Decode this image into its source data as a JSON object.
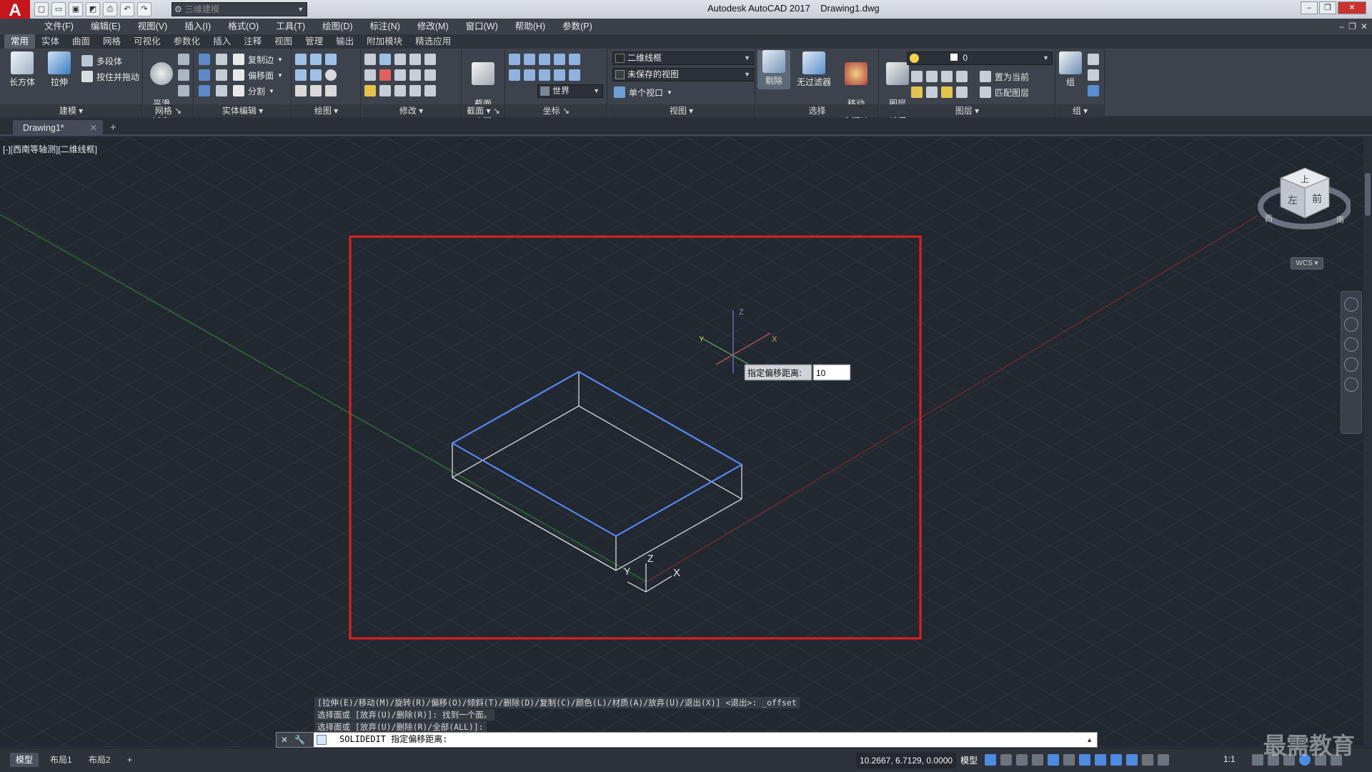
{
  "app": {
    "title": "Autodesk AutoCAD 2017    Drawing1.dwg",
    "logo_letter": "A",
    "workspace": "三维建模"
  },
  "menus": [
    "文件(F)",
    "编辑(E)",
    "视图(V)",
    "插入(I)",
    "格式(O)",
    "工具(T)",
    "绘图(D)",
    "标注(N)",
    "修改(M)",
    "窗口(W)",
    "帮助(H)",
    "参数(P)"
  ],
  "ribbon_tabs": [
    "常用",
    "实体",
    "曲面",
    "网格",
    "可视化",
    "参数化",
    "插入",
    "注释",
    "视图",
    "管理",
    "输出",
    "附加模块",
    "精选应用"
  ],
  "ribbon": {
    "modeling": {
      "box": "长方体",
      "extrude": "拉伸",
      "polysolid": "多段体",
      "presspull": "按住并拖动",
      "title": "建模"
    },
    "mesh": {
      "smooth": "平滑\n对象",
      "title": "网格"
    },
    "solid_edit": {
      "copy_edges": "复制边",
      "offset_faces": "偏移面",
      "separate": "分割",
      "title": "实体编辑"
    },
    "draw": {
      "title": "绘图"
    },
    "modify": {
      "title": "修改"
    },
    "section": {
      "plane": "截面\n平面",
      "title": "截面"
    },
    "coords": {
      "world": "世界",
      "title": "坐标"
    },
    "view": {
      "visual_style": "二维线框",
      "saved_view": "未保存的视图",
      "viewport": "单个视口",
      "title": "视图"
    },
    "selection": {
      "cull": "剔除",
      "no_filter": "无过滤器",
      "gizmo": "移动\n小控件",
      "title": "选择"
    },
    "layers": {
      "props": "图层\n特性",
      "current_layer": "0",
      "set_current": "置为当前",
      "match_layer": "匹配图层",
      "title": "图层"
    },
    "groups": {
      "group": "组",
      "title": "组"
    }
  },
  "file_tab": {
    "name": "Drawing1*"
  },
  "viewport": {
    "controls": "[-][西南等轴测][二维线框]",
    "tooltip_label": "指定偏移距离:",
    "tooltip_value": "10",
    "ucs_labels": {
      "x": "X",
      "y": "Y",
      "z": "Z"
    },
    "viewcube": {
      "top": "上",
      "left": "左",
      "front": "前",
      "west": "西",
      "south": "南"
    },
    "wcs": "WCS"
  },
  "command": {
    "history": [
      "[拉伸(E)/移动(M)/旋转(R)/偏移(O)/倾斜(T)/删除(D)/复制(C)/颜色(L)/材质(A)/放弃(U)/退出(X)] <退出>: _offset",
      "选择面或 [放弃(U)/删除(R)]: 找到一个面。",
      "选择面或 [放弃(U)/删除(R)/全部(ALL)]:"
    ],
    "current": "SOLIDEDIT 指定偏移距离:"
  },
  "status": {
    "layouts": [
      "模型",
      "布局1",
      "布局2"
    ],
    "coords": "10.2667, 6.7129, 0.0000",
    "model": "模型",
    "scale": "1:1"
  },
  "watermark": "最需教育",
  "colors": {
    "highlight_frame": "#e02020",
    "selected_face": "#5b8cff",
    "edges": "#e8e8e8"
  }
}
